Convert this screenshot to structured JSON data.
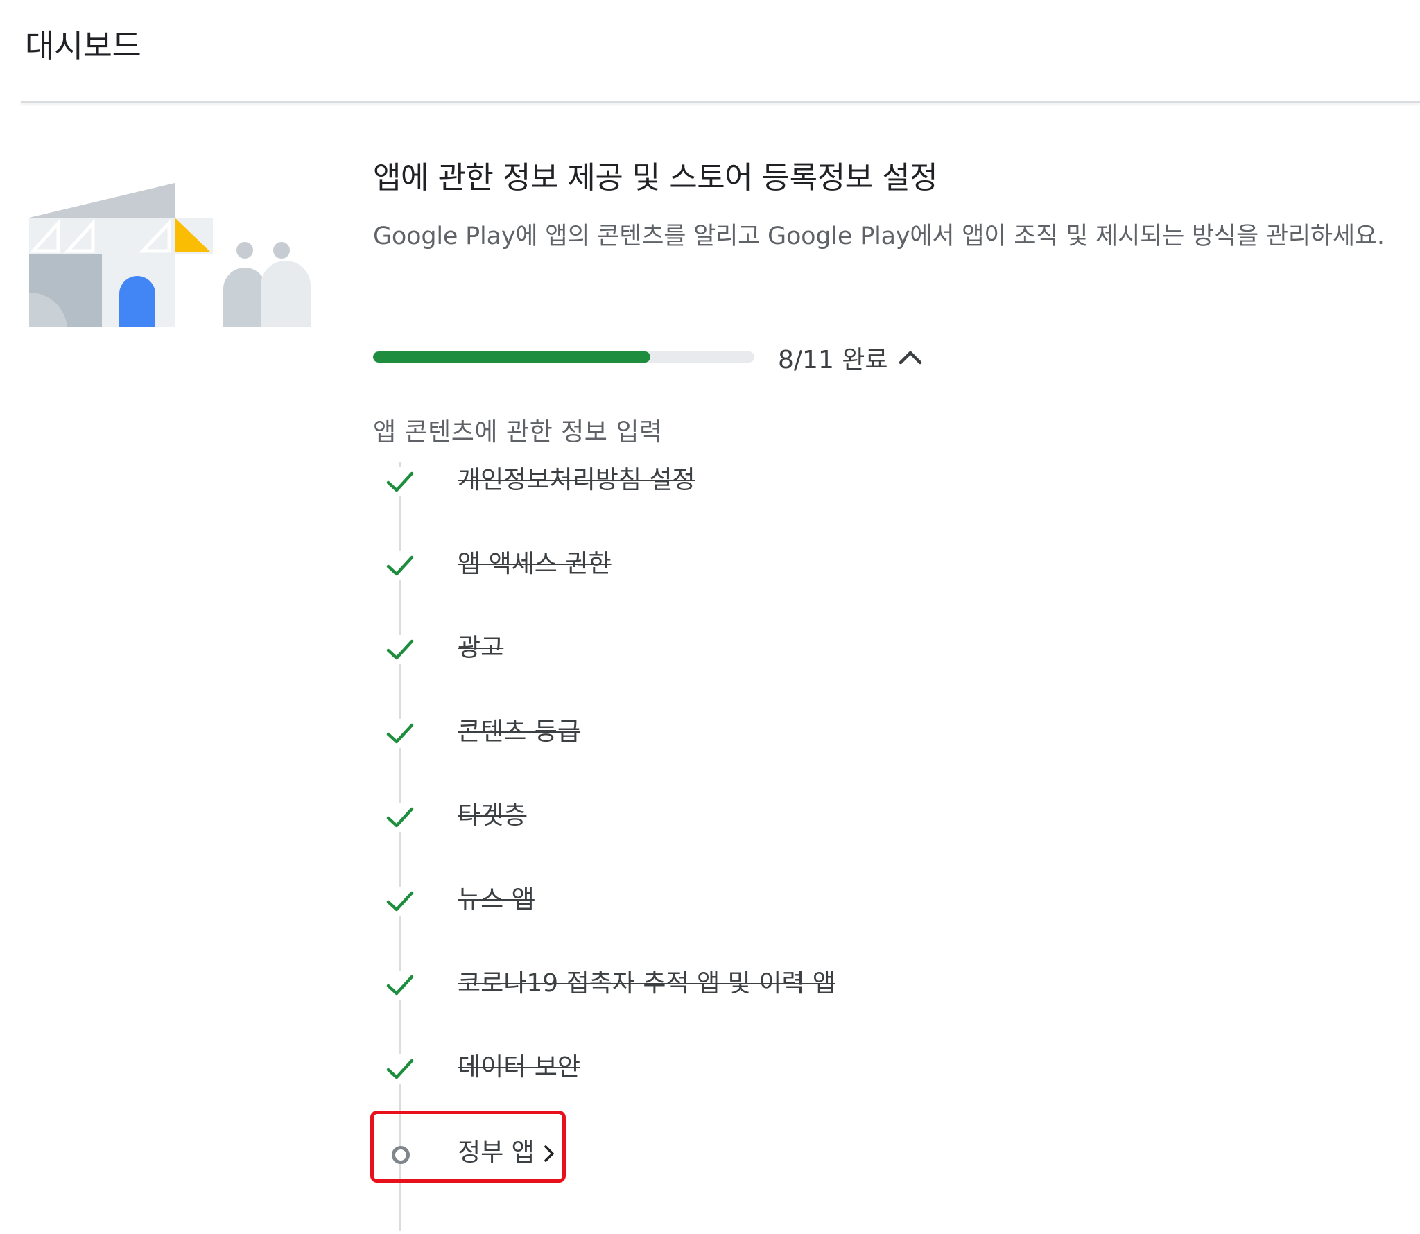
{
  "header": {
    "title": "대시보드"
  },
  "section": {
    "title": "앱에 관한 정보 제공 및 스토어 등록정보 설정",
    "description": "Google Play에 앱의 콘텐츠를 알리고 Google Play에서 앱이 조직 및 제시되는 방식을 관리하세요.",
    "progress": {
      "completed": 8,
      "total": 11,
      "fraction": 0.727,
      "label": "8/11 완료",
      "collapse_icon": "chevron-up-icon"
    },
    "group_heading": "앱 콘텐츠에 관한 정보 입력",
    "tasks": [
      {
        "label": "개인정보처리방침 설정",
        "status": "done"
      },
      {
        "label": "앱 액세스 권한",
        "status": "done"
      },
      {
        "label": "광고",
        "status": "done"
      },
      {
        "label": "콘텐츠 등급",
        "status": "done"
      },
      {
        "label": "타겟층",
        "status": "done"
      },
      {
        "label": "뉴스 앱",
        "status": "done"
      },
      {
        "label": "코로나19 접촉자 추적 앱 및 이력 앱",
        "status": "done"
      },
      {
        "label": "데이터 보안",
        "status": "done"
      },
      {
        "label": "정부 앱",
        "status": "pending"
      }
    ]
  },
  "colors": {
    "progress_fill": "#1e8e3e",
    "check": "#1e8e3e",
    "highlight": "#e8101a",
    "illustration_blue": "#4285f4",
    "illustration_yellow": "#fbbc04"
  }
}
